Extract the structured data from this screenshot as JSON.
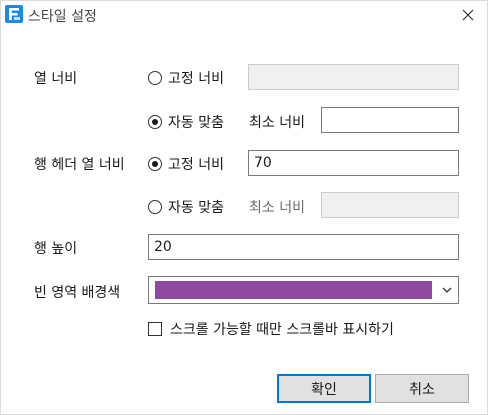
{
  "window": {
    "title": "스타일 설정",
    "icon": "app-f-icon",
    "close_icon": "close-icon"
  },
  "col_width": {
    "label": "열 너비",
    "fixed_label": "고정 너비",
    "fixed_value": "",
    "auto_label": "자동 맞춤",
    "min_label": "최소 너비",
    "min_value": "",
    "selected": "auto"
  },
  "header_col_width": {
    "label": "행 헤더 열 너비",
    "fixed_label": "고정 너비",
    "fixed_value": "70",
    "auto_label": "자동 맞춤",
    "min_label": "최소 너비",
    "min_value": "",
    "selected": "fixed"
  },
  "row_height": {
    "label": "행 높이",
    "value": "20"
  },
  "empty_bg": {
    "label": "빈 영역 배경색",
    "color": "#8e4aa0",
    "dropdown_icon": "chevron-down-icon"
  },
  "scrollbar_option": {
    "label": "스크롤 가능할 때만 스크롤바 표시하기",
    "checked": false
  },
  "buttons": {
    "ok": "확인",
    "cancel": "취소"
  },
  "colors": {
    "accent": "#0078d7",
    "icon_blue": "#1e88e5"
  }
}
